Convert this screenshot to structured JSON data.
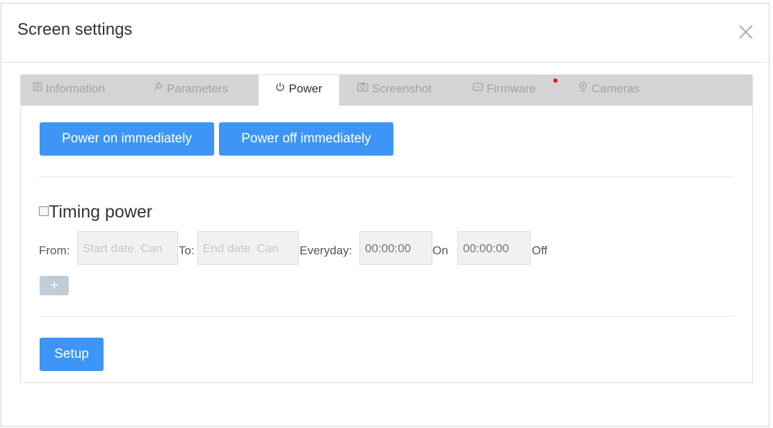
{
  "dialog": {
    "title": "Screen settings"
  },
  "tabs": [
    {
      "label": "Information",
      "icon": "information-icon",
      "active": false
    },
    {
      "label": "Parameters",
      "icon": "parameters-icon",
      "active": false
    },
    {
      "label": "Power",
      "icon": "power-icon",
      "active": true
    },
    {
      "label": "Screenshot",
      "icon": "camera-icon",
      "active": false
    },
    {
      "label": "Firmware",
      "icon": "firmware-icon",
      "active": false,
      "notification": true
    },
    {
      "label": "Cameras",
      "icon": "webcam-icon",
      "active": false
    }
  ],
  "power": {
    "power_on_label": "Power on immediately",
    "power_off_label": "Power off immediately",
    "timing_label": "Timing power",
    "timing_checked": false,
    "from_label": "From:",
    "from_placeholder": "Start date. Can",
    "to_label": "To:",
    "to_placeholder": "End date. Can",
    "everyday_label": "Everyday:",
    "on_time": "00:00:00",
    "on_label": "On",
    "off_time": "00:00:00",
    "off_label": "Off",
    "add_label": "+",
    "setup_label": "Setup"
  },
  "colors": {
    "primary": "#3d96f5",
    "tab_bar": "#d4d4d4",
    "notification": "#e8171f",
    "add_button": "#c0ccd6"
  }
}
